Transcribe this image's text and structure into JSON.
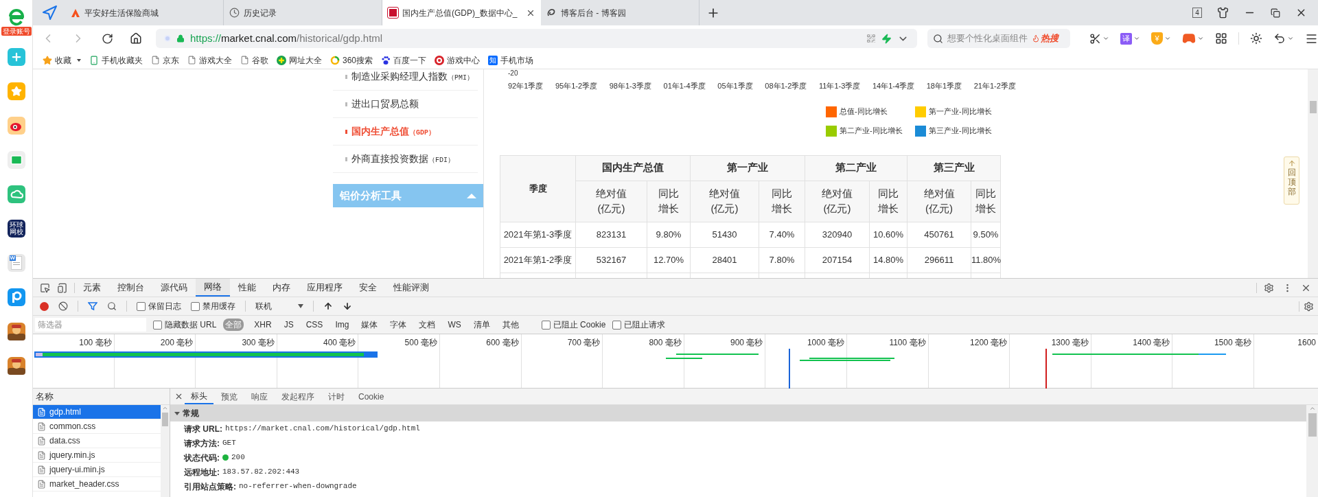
{
  "side_apps": {
    "login_label": "登录账号",
    "apps": [
      {
        "kind": "plus"
      },
      {
        "kind": "star"
      },
      {
        "kind": "weibo"
      },
      {
        "kind": "mail"
      },
      {
        "kind": "cloud"
      },
      {
        "kind": "school",
        "text": "环球网校"
      },
      {
        "kind": "doc",
        "text": "W"
      },
      {
        "kind": "pdf"
      },
      {
        "kind": "game"
      },
      {
        "kind": "game"
      }
    ]
  },
  "browser_tabs": [
    {
      "title": "平安好生活保险商城",
      "kind": "orange-a",
      "selected": false
    },
    {
      "title": "历史记录",
      "kind": "history",
      "selected": false
    },
    {
      "title": "国内生产总值(GDP)_数据中心_",
      "kind": "red-logo",
      "selected": true
    },
    {
      "title": "博客后台 - 博客园",
      "kind": "swirl",
      "selected": false
    }
  ],
  "tab_count": "4",
  "address": {
    "scheme": "https://",
    "host": "market.cnal.com",
    "path": "/historical/gdp.html"
  },
  "search": {
    "placeholder": "想要个性化桌面组件",
    "hot": "热搜"
  },
  "toolbar": {
    "translate": "译",
    "money": "¥"
  },
  "bookmarks": [
    {
      "label": "收藏",
      "kind": "star"
    },
    {
      "label": "手机收藏夹",
      "kind": "phone"
    },
    {
      "label": "京东",
      "kind": "page"
    },
    {
      "label": "游戏大全",
      "kind": "page"
    },
    {
      "label": "谷歌",
      "kind": "page"
    },
    {
      "label": "网址大全",
      "kind": "plus"
    },
    {
      "label": "360搜索",
      "kind": "ring"
    },
    {
      "label": "百度一下",
      "kind": "paw"
    },
    {
      "label": "游戏中心",
      "kind": "red"
    },
    {
      "label": "手机市场",
      "kind": "badge",
      "badge": "知"
    }
  ],
  "page": {
    "nav_items": [
      {
        "label": "制造业采购经理人指数",
        "code": "（PMI）",
        "selected": false
      },
      {
        "label": "进出口贸易总额",
        "selected": false
      },
      {
        "label": "国内生产总值",
        "code": "（GDP）",
        "selected": true
      },
      {
        "label": "外商直接投资数据",
        "code": "（FDI）",
        "selected": false
      }
    ],
    "nav_section": {
      "label": "铝价分析工具",
      "expanded": true
    },
    "chart": {
      "y_tick": "-20",
      "x_labels": [
        "92年1季度",
        "95年1-2季度",
        "98年1-3季度",
        "01年1-4季度",
        "05年1季度",
        "08年1-2季度",
        "11年1-3季度",
        "14年1-4季度",
        "18年1季度",
        "21年1-2季度"
      ],
      "legend": [
        {
          "label": "总值-同比增长",
          "color": "#ff6600"
        },
        {
          "label": "第一产业-同比增长",
          "color": "#ffcc00"
        },
        {
          "label": "第二产业-同比增长",
          "color": "#99cc00"
        },
        {
          "label": "第三产业-同比增长",
          "color": "#1b8bd6"
        }
      ]
    },
    "table": {
      "first_header": "季度",
      "groups": [
        {
          "name": "国内生产总值",
          "columns": [
            "绝对值\n(亿元)",
            "同比增长"
          ]
        },
        {
          "name": "第一产业",
          "columns": [
            "绝对值\n(亿元)",
            "同比增长"
          ]
        },
        {
          "name": "第二产业",
          "columns": [
            "绝对值\n(亿元)",
            "同比增长"
          ]
        },
        {
          "name": "第三产业",
          "columns": [
            "绝对值\n(亿元)",
            "同比增长"
          ]
        }
      ],
      "rows": [
        [
          "2021年第1-3季度",
          "823131",
          "9.80%",
          "51430",
          "7.40%",
          "320940",
          "10.60%",
          "450761",
          "9.50%"
        ],
        [
          "2021年第1-2季度",
          "532167",
          "12.70%",
          "28401",
          "7.80%",
          "207154",
          "14.80%",
          "296611",
          "11.80%"
        ]
      ]
    },
    "back_to_top": "回顶部"
  },
  "devtools": {
    "tabs": [
      {
        "label": "元素",
        "selected": false
      },
      {
        "label": "控制台",
        "selected": false
      },
      {
        "label": "源代码",
        "selected": false
      },
      {
        "label": "网络",
        "selected": true
      },
      {
        "label": "性能",
        "selected": false
      },
      {
        "label": "内存",
        "selected": false
      },
      {
        "label": "应用程序",
        "selected": false
      },
      {
        "label": "安全",
        "selected": false
      },
      {
        "label": "性能评测",
        "selected": false
      }
    ],
    "recording": true,
    "preserve_log": {
      "label": "保留日志",
      "checked": false
    },
    "disable_cache": {
      "label": "禁用缓存",
      "checked": false
    },
    "throttle": "联机",
    "filter": {
      "placeholder": "筛选器",
      "hide_data_urls": {
        "label": "隐藏数据 URL",
        "checked": false
      },
      "types": [
        {
          "label": "全部",
          "selected": true
        },
        {
          "label": "XHR",
          "selected": false
        },
        {
          "label": "JS",
          "selected": false
        },
        {
          "label": "CSS",
          "selected": false
        },
        {
          "label": "Img",
          "selected": false
        },
        {
          "label": "媒体",
          "selected": false
        },
        {
          "label": "字体",
          "selected": false
        },
        {
          "label": "文档",
          "selected": false
        },
        {
          "label": "WS",
          "selected": false
        },
        {
          "label": "清单",
          "selected": false
        },
        {
          "label": "其他",
          "selected": false
        }
      ],
      "blocked_cookies": {
        "label": "已阻止 Cookie",
        "checked": false
      },
      "blocked_requests": {
        "label": "已阻止请求",
        "checked": false
      }
    },
    "timeline_ticks": [
      "100 毫秒",
      "200 毫秒",
      "300 毫秒",
      "400 毫秒",
      "500 毫秒",
      "600 毫秒",
      "700 毫秒",
      "800 毫秒",
      "900 毫秒",
      "1000 毫秒",
      "1100 毫秒",
      "1200 毫秒",
      "1300 毫秒",
      "1400 毫秒",
      "1500 毫秒",
      "1600"
    ],
    "requests": {
      "header": "名称",
      "items": [
        {
          "name": "gdp.html",
          "selected": true
        },
        {
          "name": "common.css",
          "selected": false
        },
        {
          "name": "data.css",
          "selected": false
        },
        {
          "name": "jquery.min.js",
          "selected": false
        },
        {
          "name": "jquery-ui.min.js",
          "selected": false
        },
        {
          "name": "market_header.css",
          "selected": false
        }
      ]
    },
    "detail": {
      "tabs": [
        {
          "label": "标头",
          "selected": true
        },
        {
          "label": "预览",
          "selected": false
        },
        {
          "label": "响应",
          "selected": false
        },
        {
          "label": "发起程序",
          "selected": false
        },
        {
          "label": "计时",
          "selected": false
        },
        {
          "label": "Cookie",
          "selected": false
        }
      ],
      "section": {
        "title": "常规",
        "expanded": true
      },
      "fields": [
        {
          "key": "请求 URL:",
          "value": "https://market.cnal.com/historical/gdp.html"
        },
        {
          "key": "请求方法:",
          "value": "GET"
        },
        {
          "key": "状态代码:",
          "value": "200",
          "color": "#1db33f"
        },
        {
          "key": "远程地址:",
          "value": "183.57.82.202:443"
        },
        {
          "key": "引用站点策略:",
          "value": "no-referrer-when-downgrade"
        }
      ]
    }
  }
}
